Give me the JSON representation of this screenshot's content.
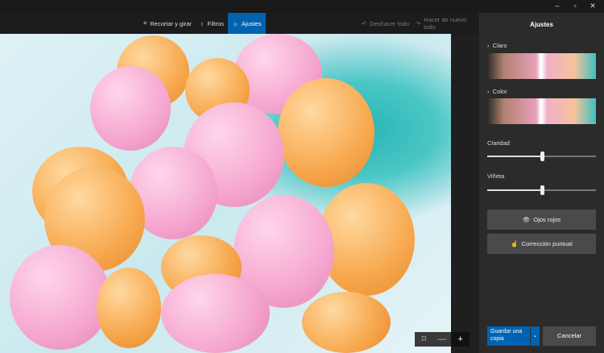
{
  "window": {
    "minimize": "–",
    "maximize": "▫",
    "close": "✕"
  },
  "toolbar": {
    "crop": {
      "label": "Recortar y girar",
      "icon": "crop-icon"
    },
    "filters": {
      "label": "Filtros",
      "icon": "filter-icon"
    },
    "adjust": {
      "label": "Ajustes",
      "icon": "brightness-icon"
    },
    "undo_all": "Deshacer todo",
    "redo_all": "Hacer de nuevo todo"
  },
  "panel": {
    "title": "Ajustes",
    "light": "Claro",
    "color": "Color",
    "clarity": {
      "label": "Claridad",
      "value": 50
    },
    "vignette": {
      "label": "Viñeta",
      "value": 50
    },
    "red_eye": "Ojos rojos",
    "spot_fix": "Corrección puntual",
    "save_copy": "Guardar una copia",
    "cancel": "Cancelar"
  },
  "zoom": {
    "fit": "⌑",
    "minus": "—",
    "plus": "+"
  },
  "colors": {
    "accent": "#0063b1",
    "panel": "#2b2b2b"
  }
}
